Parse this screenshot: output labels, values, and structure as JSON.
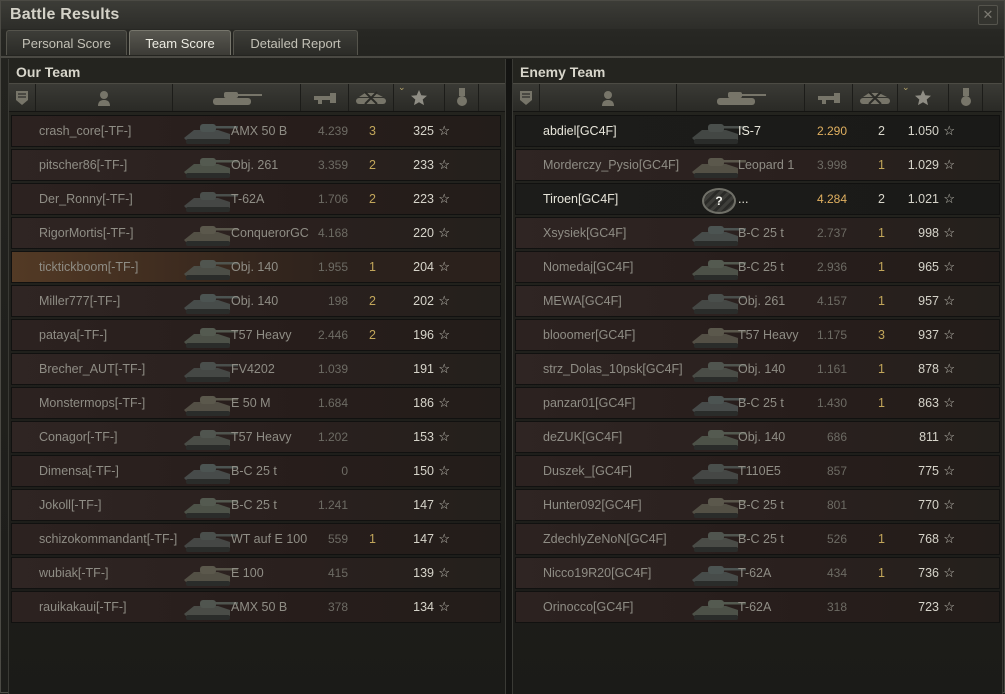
{
  "window": {
    "title": "Battle Results"
  },
  "tabs": [
    {
      "label": "Personal Score"
    },
    {
      "label": "Team Score"
    },
    {
      "label": "Detailed Report"
    }
  ],
  "icons": {
    "column_icons": [
      "platoon-icon",
      "player-icon",
      "tank-icon",
      "damage-icon",
      "kills-icon",
      "experience-star-icon",
      "medal-icon"
    ],
    "star_glyph": "☆"
  },
  "our_team": {
    "title": "Our Team",
    "rows": [
      {
        "name": "crash_core[-TF-]",
        "vehicle": "AMX 50 B",
        "damage": "4.239",
        "kills": "3",
        "xp": "325"
      },
      {
        "name": "pitscher86[-TF-]",
        "vehicle": "Obj. 261",
        "damage": "3.359",
        "kills": "2",
        "xp": "233"
      },
      {
        "name": "Der_Ronny[-TF-]",
        "vehicle": "T-62A",
        "damage": "1.706",
        "kills": "2",
        "xp": "223"
      },
      {
        "name": "RigorMortis[-TF-]",
        "vehicle": "ConquerorGC",
        "damage": "4.168",
        "kills": "",
        "xp": "220"
      },
      {
        "name": "ticktickboom[-TF-]",
        "vehicle": "Obj. 140",
        "damage": "1.955",
        "kills": "1",
        "xp": "204"
      },
      {
        "name": "Miller777[-TF-]",
        "vehicle": "Obj. 140",
        "damage": "198",
        "kills": "2",
        "xp": "202"
      },
      {
        "name": "pataya[-TF-]",
        "vehicle": "T57 Heavy",
        "damage": "2.446",
        "kills": "2",
        "xp": "196"
      },
      {
        "name": "Brecher_AUT[-TF-]",
        "vehicle": "FV4202",
        "damage": "1.039",
        "kills": "",
        "xp": "191"
      },
      {
        "name": "Monstermops[-TF-]",
        "vehicle": "E 50 M",
        "damage": "1.684",
        "kills": "",
        "xp": "186"
      },
      {
        "name": "Conagor[-TF-]",
        "vehicle": "T57 Heavy",
        "damage": "1.202",
        "kills": "",
        "xp": "153"
      },
      {
        "name": "Dimensa[-TF-]",
        "vehicle": "B-C 25 t",
        "damage": "0",
        "kills": "",
        "xp": "150"
      },
      {
        "name": "Jokoll[-TF-]",
        "vehicle": "B-C 25 t",
        "damage": "1.241",
        "kills": "",
        "xp": "147"
      },
      {
        "name": "schizokommandant[-TF-]",
        "vehicle": "WT auf E 100",
        "damage": "559",
        "kills": "1",
        "xp": "147"
      },
      {
        "name": "wubiak[-TF-]",
        "vehicle": "E 100",
        "damage": "415",
        "kills": "",
        "xp": "139"
      },
      {
        "name": "rauikakaui[-TF-]",
        "vehicle": "AMX 50 B",
        "damage": "378",
        "kills": "",
        "xp": "134"
      }
    ]
  },
  "enemy_team": {
    "title": "Enemy Team",
    "rows": [
      {
        "name": "abdiel[GC4F]",
        "vehicle": "IS-7",
        "damage": "2.290",
        "kills": "2",
        "xp": "1.050"
      },
      {
        "name": "Morderczy_Pysio[GC4F]",
        "vehicle": "Leopard 1",
        "damage": "3.998",
        "kills": "1",
        "xp": "1.029"
      },
      {
        "name": "Tiroen[GC4F]",
        "vehicle": "...",
        "damage": "4.284",
        "kills": "2",
        "xp": "1.021",
        "unknown_tank": "?"
      },
      {
        "name": "Xsysiek[GC4F]",
        "vehicle": "B-C 25 t",
        "damage": "2.737",
        "kills": "1",
        "xp": "998"
      },
      {
        "name": "Nomedaj[GC4F]",
        "vehicle": "B-C 25 t",
        "damage": "2.936",
        "kills": "1",
        "xp": "965"
      },
      {
        "name": "MEWA[GC4F]",
        "vehicle": "Obj. 261",
        "damage": "4.157",
        "kills": "1",
        "xp": "957"
      },
      {
        "name": "blooomer[GC4F]",
        "vehicle": "T57 Heavy",
        "damage": "1.175",
        "kills": "3",
        "xp": "937"
      },
      {
        "name": "strz_Dolas_10psk[GC4F]",
        "vehicle": "Obj. 140",
        "damage": "1.161",
        "kills": "1",
        "xp": "878"
      },
      {
        "name": "panzar01[GC4F]",
        "vehicle": "B-C 25 t",
        "damage": "1.430",
        "kills": "1",
        "xp": "863"
      },
      {
        "name": "deZUK[GC4F]",
        "vehicle": "Obj. 140",
        "damage": "686",
        "kills": "",
        "xp": "811"
      },
      {
        "name": "Duszek_[GC4F]",
        "vehicle": "T110E5",
        "damage": "857",
        "kills": "",
        "xp": "775"
      },
      {
        "name": "Hunter092[GC4F]",
        "vehicle": "B-C 25 t",
        "damage": "801",
        "kills": "",
        "xp": "770"
      },
      {
        "name": "ZdechlyZeNoN[GC4F]",
        "vehicle": "B-C 25 t",
        "damage": "526",
        "kills": "1",
        "xp": "768"
      },
      {
        "name": "Nicco19R20[GC4F]",
        "vehicle": "T-62A",
        "damage": "434",
        "kills": "1",
        "xp": "736"
      },
      {
        "name": "Orinocco[GC4F]",
        "vehicle": "T-62A",
        "damage": "318",
        "kills": "",
        "xp": "723"
      }
    ]
  },
  "colors": {
    "highlight_row": "#533a25",
    "damage_bright": "#e0b060",
    "kills": "#c2a65a"
  }
}
